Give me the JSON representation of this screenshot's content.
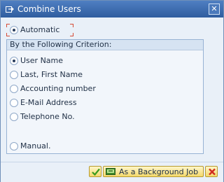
{
  "dialog": {
    "title": "Combine Users",
    "close_label": "✕"
  },
  "options": {
    "automatic": "Automatic",
    "manual": "Manual."
  },
  "criterion": {
    "title": "By the Following Criterion:",
    "items": [
      {
        "label": "User Name",
        "checked": true
      },
      {
        "label": "Last, First Name",
        "checked": false
      },
      {
        "label": "Accounting number",
        "checked": false
      },
      {
        "label": "E-Mail Address",
        "checked": false
      },
      {
        "label": "Telephone No.",
        "checked": false
      }
    ]
  },
  "buttons": {
    "background_job": "As a Background Job"
  },
  "icons": {
    "title": "combine-users-icon",
    "ok": "checkmark-icon",
    "background_job": "background-job-icon",
    "cancel": "cancel-icon",
    "close": "close-icon"
  },
  "colors": {
    "title_bar": "#2f5d9f",
    "dialog_bg": "#e9f0f8",
    "focus_frame": "#d64a35",
    "button_bg": "#f4d96b",
    "ok_icon": "#3a9b1f",
    "cancel_icon": "#d12b1f"
  }
}
